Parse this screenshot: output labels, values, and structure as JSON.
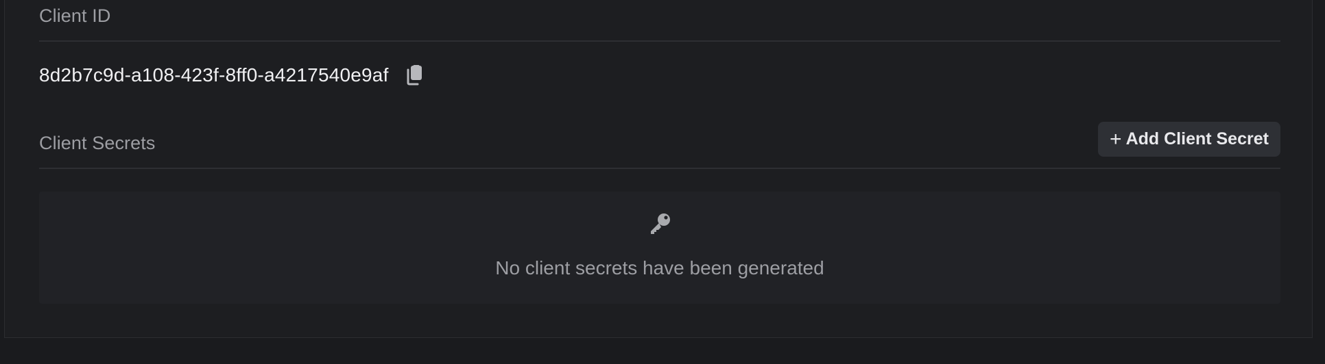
{
  "client_id": {
    "label": "Client ID",
    "value": "8d2b7c9d-a108-423f-8ff0-a4217540e9af",
    "copy_icon": "copy-icon"
  },
  "client_secrets": {
    "label": "Client Secrets",
    "add_button": {
      "icon": "plus-icon",
      "plus_glyph": "+",
      "label": "Add Client Secret"
    },
    "empty_state": {
      "icon": "key-icon",
      "message": "No client secrets have been generated"
    }
  },
  "colors": {
    "background": "#1a1b1e",
    "panel": "#1d1e21",
    "button": "#2e3035",
    "muted_text": "#9d9ea3",
    "primary_text": "#f1f1f3"
  }
}
